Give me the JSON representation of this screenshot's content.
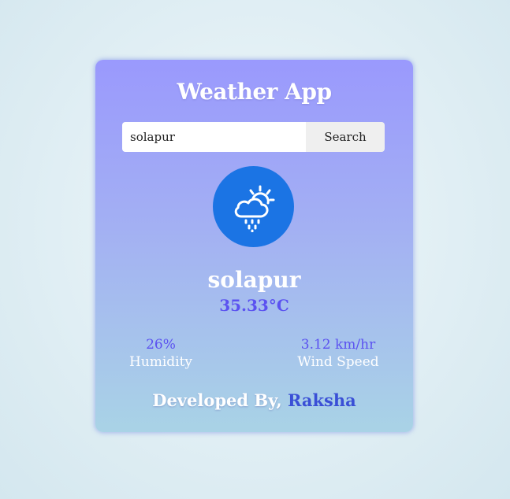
{
  "app": {
    "title": "Weather App"
  },
  "search": {
    "value": "solapur",
    "placeholder": "",
    "button_label": "Search"
  },
  "weather": {
    "icon": "cloud-sun-rain-icon",
    "city": "solapur",
    "temperature": "35.33°C"
  },
  "stats": {
    "humidity_value": "26%",
    "humidity_label": "Humidity",
    "wind_value": "3.12 km/hr",
    "wind_label": "Wind Speed"
  },
  "footer": {
    "prefix": "Developed By, ",
    "author": "Raksha"
  },
  "colors": {
    "card_top": "#9a99fd",
    "card_bottom": "#a9d3e6",
    "accent": "#5b52f0",
    "icon_bg": "#1b74e4",
    "author": "#3a4fd6"
  }
}
